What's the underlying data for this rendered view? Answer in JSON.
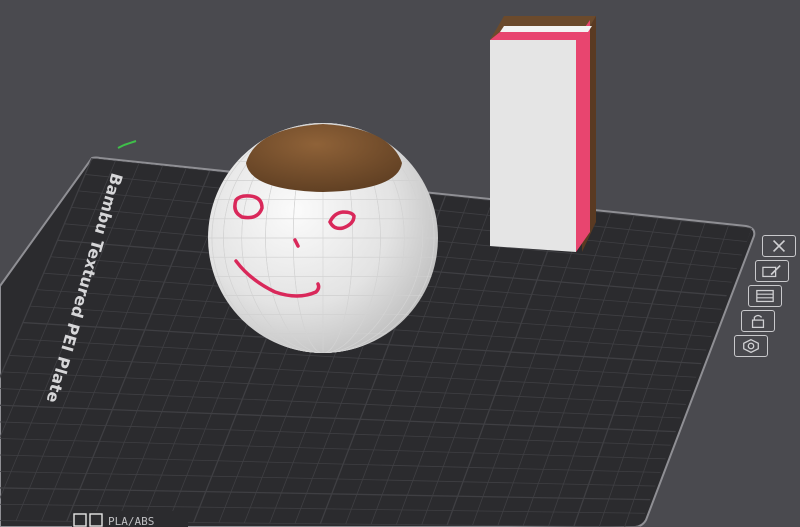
{
  "viewport": {
    "background": "#4a4a4f",
    "plate": {
      "name": "Bambu Textured PEI Plate",
      "bottom_label": "PLA/ABS",
      "surface_color": "#2b2b2e",
      "grid_color": "#3f3f43",
      "edge_color": "#8f8f94"
    },
    "objects": {
      "sphere": {
        "body_color": "#e9e9e9",
        "cap_color": "#7a5230",
        "face_color": "#d9285a"
      },
      "block": {
        "body_color": "#e5e5e5",
        "stripe_color": "#e8456f",
        "top_color": "#6b4a2c"
      }
    },
    "side_toolbar": [
      {
        "icon": "close-icon",
        "tooltip": ""
      },
      {
        "icon": "edit-plate-icon",
        "tooltip": ""
      },
      {
        "icon": "arrange-icon",
        "tooltip": ""
      },
      {
        "icon": "lock-icon",
        "tooltip": ""
      },
      {
        "icon": "settings-icon",
        "tooltip": ""
      }
    ],
    "axis_indicator_color": "#3fbf4a"
  }
}
